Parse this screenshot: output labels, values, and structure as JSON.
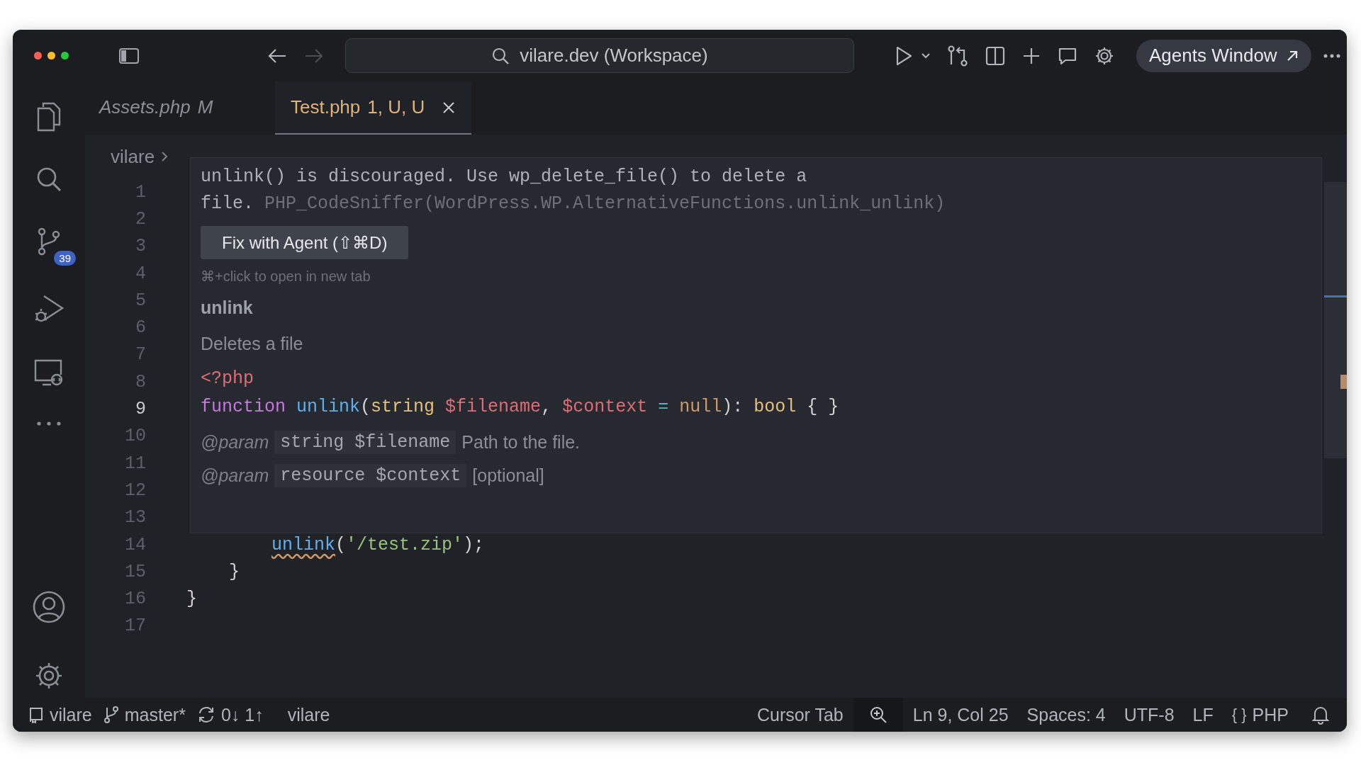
{
  "title_bar": {
    "back_enabled": true,
    "forward_enabled": false,
    "search": "vilare.dev (Workspace)",
    "agents_button": "Agents Window"
  },
  "tabs": [
    {
      "label": "Assets.php",
      "status": "M",
      "preview": true,
      "selected": false
    },
    {
      "label": "Test.php",
      "status": "1, U, U",
      "preview": false,
      "selected": true
    }
  ],
  "activity_bar": {
    "source_control_badge": "39"
  },
  "breadcrumb": [
    "vilare"
  ],
  "editor": {
    "lines": [
      {
        "number": "1",
        "active": false
      },
      {
        "number": "2",
        "active": false
      },
      {
        "number": "3",
        "active": false
      },
      {
        "number": "4",
        "active": false
      },
      {
        "number": "5",
        "active": false
      },
      {
        "number": "6",
        "active": false
      },
      {
        "number": "7",
        "active": false
      },
      {
        "number": "8",
        "active": false
      },
      {
        "number": "9",
        "active": true
      },
      {
        "number": "10",
        "active": false
      },
      {
        "number": "11",
        "active": false
      },
      {
        "number": "12",
        "active": false
      },
      {
        "number": "13",
        "active": false
      },
      {
        "number": "14",
        "active": false,
        "kind": "statement",
        "tokens": [
          {
            "text": "unlink",
            "kind": "function",
            "warning": true
          },
          {
            "text": "(",
            "kind": "punct"
          },
          {
            "text": "'/test.zip'",
            "kind": "string"
          },
          {
            "text": ");",
            "kind": "punct"
          }
        ]
      },
      {
        "number": "15",
        "active": false,
        "kind": "method_end",
        "tokens": [
          {
            "text": "}",
            "kind": "punct"
          }
        ]
      },
      {
        "number": "16",
        "active": false,
        "kind": "class_end",
        "tokens": [
          {
            "text": "}",
            "kind": "punct"
          }
        ]
      },
      {
        "number": "17",
        "active": false
      }
    ]
  },
  "hover": {
    "message": "unlink() is discouraged. Use wp_delete_file() to delete a file.",
    "source": "PHP_CodeSniffer(WordPress.WP.AlternativeFunctions.unlink_unlink)",
    "fix_button": "Fix with Agent (⇧⌘D)",
    "hint": "⌘+click to open in new tab",
    "symbol": "unlink",
    "description": "Deletes a file",
    "php_tag": "<?php",
    "signature": [
      {
        "text": "function ",
        "kind": "keyword"
      },
      {
        "text": "unlink",
        "kind": "function"
      },
      {
        "text": "(",
        "kind": "punct"
      },
      {
        "text": "string ",
        "kind": "type"
      },
      {
        "text": "$filename",
        "kind": "variable"
      },
      {
        "text": ", ",
        "kind": "punct"
      },
      {
        "text": "$context",
        "kind": "variable"
      },
      {
        "text": " = ",
        "kind": "operator"
      },
      {
        "text": "null",
        "kind": "constant"
      },
      {
        "text": "): ",
        "kind": "punct"
      },
      {
        "text": "bool",
        "kind": "type"
      },
      {
        "text": " { }",
        "kind": "punct"
      }
    ],
    "params": [
      {
        "tag": "@param",
        "type": "string $filename",
        "description": "Path to the file."
      },
      {
        "tag": "@param",
        "type": "resource $context",
        "description": "[optional]"
      }
    ]
  },
  "status_bar": {
    "left": [
      {
        "kind": "repo",
        "text": "vilare"
      },
      {
        "kind": "branch",
        "text": "master*"
      },
      {
        "kind": "sync",
        "text": "0↓ 1↑"
      },
      {
        "kind": "plain",
        "text": "vilare"
      }
    ],
    "right": [
      {
        "kind": "plain",
        "text": "Cursor Tab"
      },
      {
        "kind": "zoom"
      },
      {
        "kind": "plain",
        "text": "Ln 9, Col 25"
      },
      {
        "kind": "plain",
        "text": "Spaces: 4"
      },
      {
        "kind": "plain",
        "text": "UTF-8"
      },
      {
        "kind": "plain",
        "text": "LF"
      },
      {
        "kind": "language",
        "icon": "{ }",
        "text": "PHP"
      },
      {
        "kind": "bell"
      }
    ]
  }
}
